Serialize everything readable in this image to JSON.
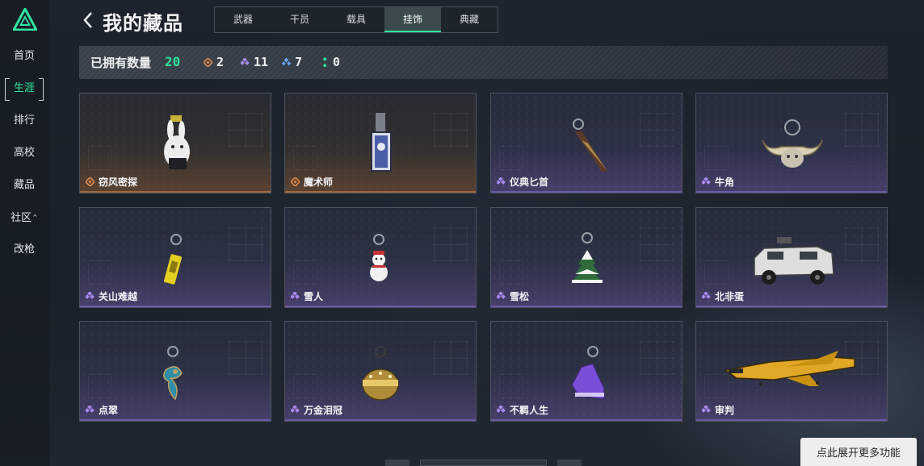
{
  "sidebar": {
    "items": [
      {
        "label": "首页",
        "active": false
      },
      {
        "label": "生涯",
        "active": true
      },
      {
        "label": "排行",
        "active": false
      },
      {
        "label": "高校",
        "active": false
      },
      {
        "label": "藏品",
        "active": false
      },
      {
        "label": "社区",
        "active": false,
        "caret": "^"
      },
      {
        "label": "改枪",
        "active": false
      }
    ]
  },
  "header": {
    "title": "我的藏品",
    "tabs": [
      {
        "label": "武器",
        "active": false
      },
      {
        "label": "干员",
        "active": false
      },
      {
        "label": "载具",
        "active": false
      },
      {
        "label": "挂饰",
        "active": true
      },
      {
        "label": "典藏",
        "active": false
      }
    ]
  },
  "stats": {
    "label": "已拥有数量",
    "total": "20",
    "rarities": [
      {
        "name": "orange",
        "color": "#e08a4a",
        "count": "2"
      },
      {
        "name": "purple",
        "color": "#a98af0",
        "count": "11"
      },
      {
        "name": "blue",
        "color": "#6aa8ff",
        "count": "7"
      },
      {
        "name": "green",
        "color": "#2fe5a0",
        "count": "0"
      }
    ]
  },
  "items": [
    {
      "name": "窃风密探",
      "rarity": "orange",
      "icon": "rabbit-charm-icon"
    },
    {
      "name": "魔术师",
      "rarity": "orange",
      "icon": "tarot-card-charm-icon"
    },
    {
      "name": "仪典匕首",
      "rarity": "purple",
      "icon": "dagger-charm-icon"
    },
    {
      "name": "牛角",
      "rarity": "purple",
      "icon": "bull-horn-charm-icon"
    },
    {
      "name": "关山难越",
      "rarity": "purple",
      "icon": "yellow-can-charm-icon"
    },
    {
      "name": "雪人",
      "rarity": "purple",
      "icon": "snowman-charm-icon"
    },
    {
      "name": "雪松",
      "rarity": "purple",
      "icon": "snow-pine-charm-icon"
    },
    {
      "name": "北非蛋",
      "rarity": "purple",
      "icon": "armored-vehicle-icon"
    },
    {
      "name": "点翠",
      "rarity": "purple",
      "icon": "phoenix-charm-icon"
    },
    {
      "name": "万金泪冠",
      "rarity": "purple",
      "icon": "golden-crown-charm-icon"
    },
    {
      "name": "不羁人生",
      "rarity": "purple",
      "icon": "sneaker-charm-icon"
    },
    {
      "name": "审判",
      "rarity": "purple",
      "icon": "fighter-jet-icon"
    }
  ],
  "footer": {
    "expand_label": "点此展开更多功能"
  },
  "colors": {
    "accent": "#2fe5a0",
    "purple_rarity": "#a98af0",
    "orange_rarity": "#e08a4a"
  }
}
